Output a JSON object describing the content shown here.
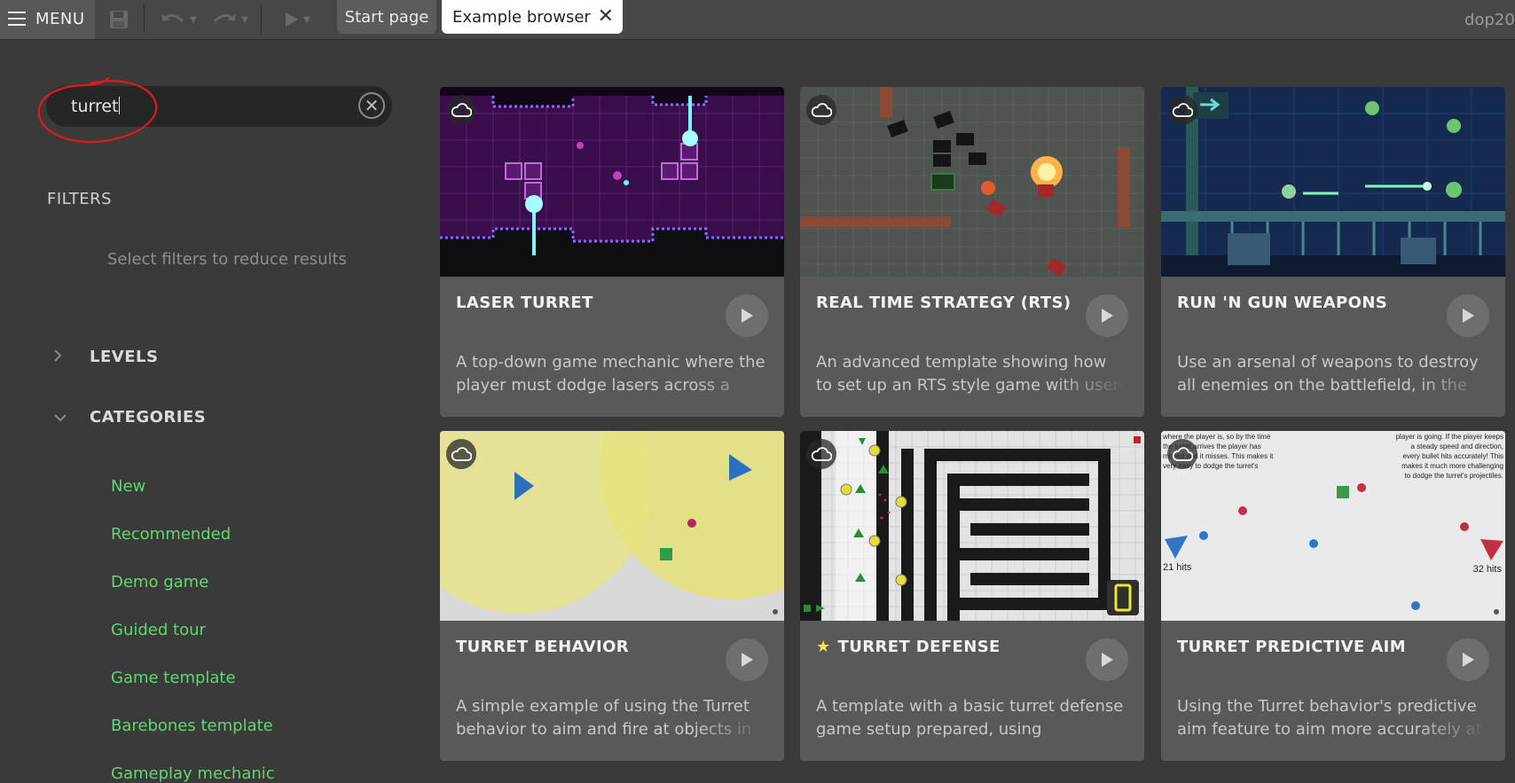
{
  "toolbar": {
    "menu_label": "MENU",
    "tabs": [
      {
        "label": "Start page"
      },
      {
        "label": "Example browser",
        "close": "✕"
      }
    ],
    "user": "dop20"
  },
  "search": {
    "value": "turret",
    "clear": "✕"
  },
  "filters": {
    "title": "FILTERS",
    "hint": "Select filters to reduce results",
    "groups": [
      {
        "label": "LEVELS",
        "collapsed": true
      },
      {
        "label": "CATEGORIES",
        "collapsed": false
      }
    ],
    "categories": [
      "New",
      "Recommended",
      "Demo game",
      "Guided tour",
      "Game template",
      "Barebones template",
      "Gameplay mechanic"
    ]
  },
  "cards": [
    {
      "title": "LASER TURRET",
      "desc": "A top-down game mechanic where the player must dodge lasers across a level.",
      "icon": "cloud-icon"
    },
    {
      "title": "REAL TIME STRATEGY (RTS)",
      "desc": "An advanced template showing how to set up an RTS style game with user-controlled units.",
      "icon": "cloud-icon"
    },
    {
      "title": "RUN 'N GUN WEAPONS",
      "desc": "Use an arsenal of weapons to destroy all enemies on the battlefield, in the style of",
      "icon": "cloud-icon"
    },
    {
      "title": "TURRET BEHAVIOR",
      "desc": "A simple example of using the Turret behavior to aim and fire at objects in",
      "icon": "cloud-icon"
    },
    {
      "title": "TURRET DEFENSE",
      "desc": "A template with a basic turret defense game setup prepared, using placeholder",
      "icon": "cloud-icon",
      "featured": true
    },
    {
      "title": "TURRET PREDICTIVE AIM",
      "desc": "Using the Turret behavior's predictive aim feature to aim more accurately at",
      "icon": "cloud-icon"
    }
  ],
  "thumb_text": {
    "predictive_left": "where the player is, so by the time the turret arrives the player has moved and it misses. This makes it very easy to dodge the turret's projectiles.",
    "predictive_right": "player is going. If the player keeps a steady speed and direction, every bullet hits accurately! This makes it much more challenging to dodge the turret's projectiles.",
    "hits_left": "21 hits",
    "hits_right": "32 hits"
  },
  "colors": {
    "accent_green": "#5fd96b",
    "annotation_red": "#e01a1a",
    "star_yellow": "#ffe24a"
  }
}
